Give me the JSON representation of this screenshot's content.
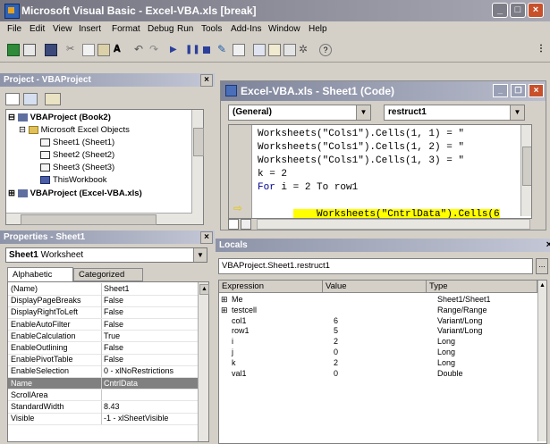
{
  "window": {
    "title": "Microsoft Visual Basic - Excel-VBA.xls [break]",
    "controls": [
      "_",
      "□",
      "×"
    ]
  },
  "menu": [
    "File",
    "Edit",
    "View",
    "Insert",
    "Format",
    "Debug",
    "Run",
    "Tools",
    "Add-Ins",
    "Window",
    "Help"
  ],
  "project_pane": {
    "title": "Project - VBAProject",
    "close": "×",
    "tree": [
      {
        "label": "VBAProject (Book2)",
        "level": 0,
        "bold": true,
        "toggle": "⊟"
      },
      {
        "label": "Microsoft Excel Objects",
        "level": 1,
        "bold": false,
        "toggle": "⊟"
      },
      {
        "label": "Sheet1 (Sheet1)",
        "level": 2,
        "bold": false,
        "toggle": ""
      },
      {
        "label": "Sheet2 (Sheet2)",
        "level": 2,
        "bold": false,
        "toggle": ""
      },
      {
        "label": "Sheet3 (Sheet3)",
        "level": 2,
        "bold": false,
        "toggle": ""
      },
      {
        "label": "ThisWorkbook",
        "level": 2,
        "bold": false,
        "toggle": ""
      },
      {
        "label": "VBAProject (Excel-VBA.xls)",
        "level": 0,
        "bold": true,
        "toggle": "⊞"
      }
    ]
  },
  "properties_pane": {
    "title": "Properties - Sheet1",
    "close": "×",
    "object_name": "Sheet1",
    "object_type": "Worksheet",
    "tabs": [
      "Alphabetic",
      "Categorized"
    ],
    "rows": [
      {
        "name": "(Name)",
        "value": "Sheet1"
      },
      {
        "name": "DisplayPageBreaks",
        "value": "False"
      },
      {
        "name": "DisplayRightToLeft",
        "value": "False"
      },
      {
        "name": "EnableAutoFilter",
        "value": "False"
      },
      {
        "name": "EnableCalculation",
        "value": "True"
      },
      {
        "name": "EnableOutlining",
        "value": "False"
      },
      {
        "name": "EnablePivotTable",
        "value": "False"
      },
      {
        "name": "EnableSelection",
        "value": "0 - xlNoRestrictions"
      },
      {
        "name": "Name",
        "value": "CntrlData"
      },
      {
        "name": "ScrollArea",
        "value": ""
      },
      {
        "name": "StandardWidth",
        "value": "8.43"
      },
      {
        "name": "Visible",
        "value": "-1 - xlSheetVisible"
      }
    ],
    "selected_row": 8
  },
  "code_window": {
    "title": "Excel-VBA.xls - Sheet1 (Code)",
    "object_combo": "(General)",
    "proc_combo": "restruct1",
    "lines": [
      {
        "text": "Worksheets(\"Cols1\").Cells(1, 1) = \"",
        "kw": ""
      },
      {
        "text": "Worksheets(\"Cols1\").Cells(1, 2) = \"",
        "kw": ""
      },
      {
        "text": "Worksheets(\"Cols1\").Cells(1, 3) = \"",
        "kw": ""
      },
      {
        "text": "k = 2",
        "kw": ""
      },
      {
        "text": "For i = 2 To row1",
        "kw": "For"
      },
      {
        "text": "    Worksheets(\"CntrlData\").Cells(6",
        "kw": ""
      }
    ],
    "current_line": 5
  },
  "locals": {
    "title": "Locals",
    "context": "VBAProject.Sheet1.restruct1",
    "context_button": "...",
    "columns": [
      "Expression",
      "Value",
      "Type"
    ],
    "rows": [
      {
        "expr": "Me",
        "value": "",
        "type": "Sheet1/Sheet1",
        "toggle": "⊞"
      },
      {
        "expr": "testcell",
        "value": "",
        "type": "Range/Range",
        "toggle": "⊞"
      },
      {
        "expr": "col1",
        "value": "6",
        "type": "Variant/Long",
        "toggle": ""
      },
      {
        "expr": "row1",
        "value": "5",
        "type": "Variant/Long",
        "toggle": ""
      },
      {
        "expr": "i",
        "value": "2",
        "type": "Long",
        "toggle": ""
      },
      {
        "expr": "j",
        "value": "0",
        "type": "Long",
        "toggle": ""
      },
      {
        "expr": "k",
        "value": "2",
        "type": "Long",
        "toggle": ""
      },
      {
        "expr": "val1",
        "value": "0",
        "type": "Double",
        "toggle": ""
      }
    ]
  },
  "colors": {
    "title_active": "#737380",
    "selection": "#808080",
    "highlight": "#ffff00",
    "close_red": "#c8502a"
  }
}
